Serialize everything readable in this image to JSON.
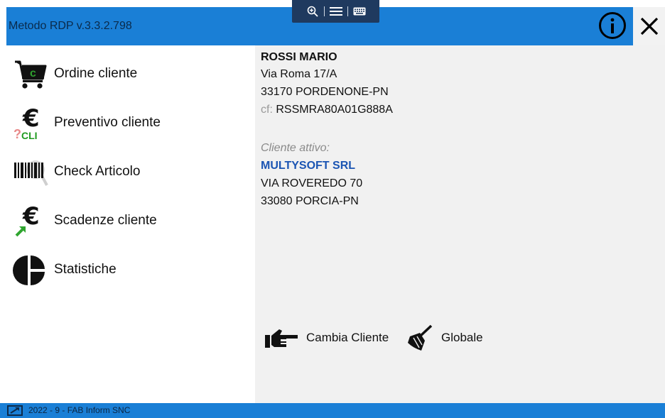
{
  "app": {
    "title": "Metodo RDP v.3.3.2.798"
  },
  "toolbox": {
    "icons": [
      "zoom-in-icon",
      "menu-icon",
      "keyboard-icon"
    ]
  },
  "header_icons": [
    "info-icon",
    "close-icon"
  ],
  "sidebar": {
    "items": [
      {
        "label": "Ordine cliente",
        "icon": "shopping-cart-icon"
      },
      {
        "label": "Preventivo cliente",
        "icon": "euro-quote-icon"
      },
      {
        "label": "Check Articolo",
        "icon": "barcode-search-icon"
      },
      {
        "label": "Scadenze cliente",
        "icon": "euro-arrow-icon"
      },
      {
        "label": "Statistiche",
        "icon": "pie-chart-icon"
      }
    ]
  },
  "user": {
    "name": "ROSSI MARIO",
    "address": "Via Roma 17/A",
    "city": "33170 PORDENONE-PN",
    "cf_label": "cf:",
    "cf_value": "RSSMRA80A01G888A"
  },
  "active_client": {
    "label": "Cliente attivo:",
    "name": "MULTYSOFT SRL",
    "address": "VIA ROVEREDO 70",
    "city": "33080 PORCIA-PN"
  },
  "actions": {
    "change_client": "Cambia Cliente",
    "global": "Globale"
  },
  "status": {
    "text": "2022 - 9 - FAB Inform SNC"
  },
  "colors": {
    "accent": "#1a7fd6",
    "client_name": "#1b55b3",
    "panel_bg": "#f1f1f1"
  }
}
